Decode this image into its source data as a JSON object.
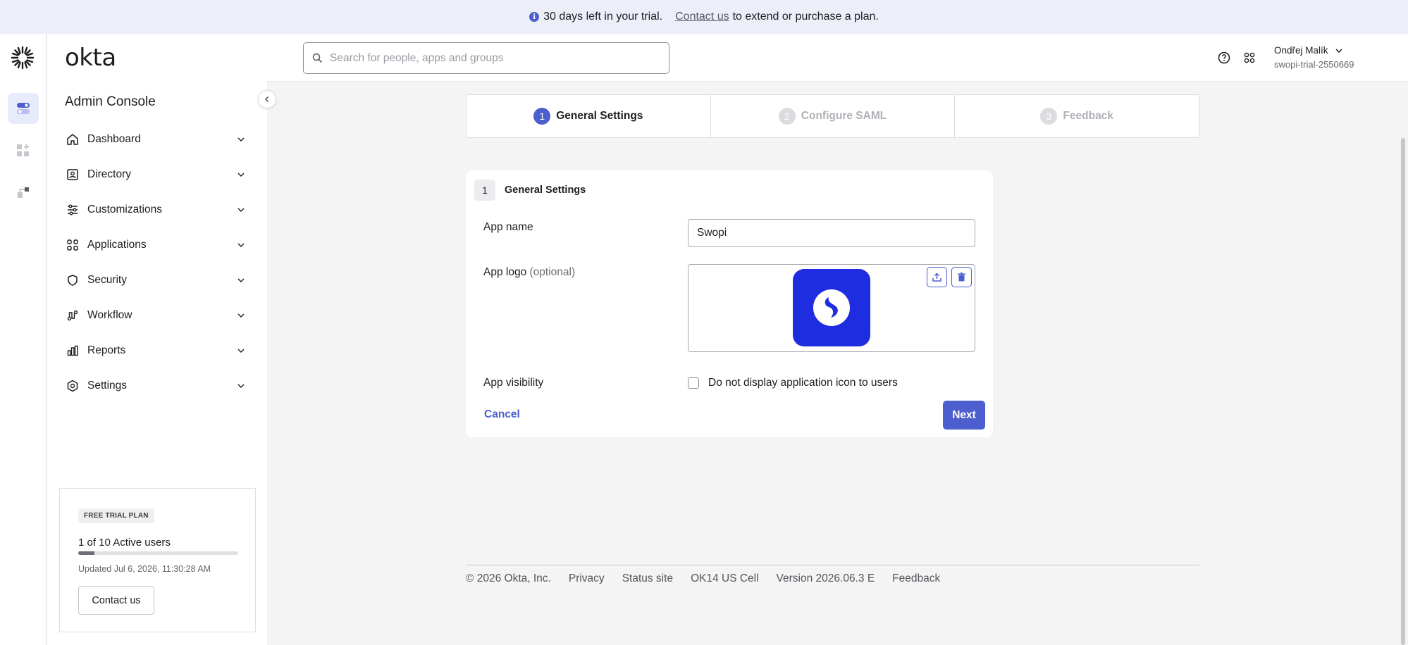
{
  "banner": {
    "message": "30 days left in your trial.",
    "link_text": "Contact us",
    "suffix": "to extend or purchase a plan."
  },
  "sidebar": {
    "brand": "okta",
    "title": "Admin Console",
    "items": [
      {
        "label": "Dashboard",
        "icon": "home-icon"
      },
      {
        "label": "Directory",
        "icon": "directory-icon"
      },
      {
        "label": "Customizations",
        "icon": "sliders-icon"
      },
      {
        "label": "Applications",
        "icon": "grid-icon"
      },
      {
        "label": "Security",
        "icon": "shield-icon"
      },
      {
        "label": "Workflow",
        "icon": "workflow-icon"
      },
      {
        "label": "Reports",
        "icon": "bar-chart-icon"
      },
      {
        "label": "Settings",
        "icon": "gear-icon"
      }
    ],
    "trial": {
      "badge": "FREE TRIAL PLAN",
      "users": "1 of 10 Active users",
      "users_fraction": 0.1,
      "updated": "Updated Jul 6, 2026, 11:30:28 AM",
      "contact_label": "Contact us"
    }
  },
  "header": {
    "search_placeholder": "Search for people, apps and groups",
    "user_name": "Ondřej Malík",
    "org": "swopi-trial-2550669"
  },
  "steps": [
    {
      "num": "1",
      "label": "General Settings",
      "state": "active"
    },
    {
      "num": "2",
      "label": "Configure SAML",
      "state": "inactive"
    },
    {
      "num": "3",
      "label": "Feedback",
      "state": "inactive"
    }
  ],
  "form": {
    "section_num": "1",
    "section_title": "General Settings",
    "app_name_label": "App name",
    "app_name_value": "Swopi",
    "app_logo_label": "App logo",
    "app_logo_optional": "(optional)",
    "app_visibility_label": "App visibility",
    "visibility_checkbox_label": "Do not display application icon to users",
    "visibility_checked": false,
    "cancel_label": "Cancel",
    "next_label": "Next"
  },
  "footer": {
    "copyright": "© 2026 Okta, Inc.",
    "privacy": "Privacy",
    "status_site": "Status site",
    "cell": "OK14 US Cell",
    "version": "Version 2026.06.3 E",
    "feedback": "Feedback"
  },
  "colors": {
    "accent": "#4d5fcf",
    "app_logo_bg": "#1f2de0",
    "banner_bg": "#eceef8"
  }
}
